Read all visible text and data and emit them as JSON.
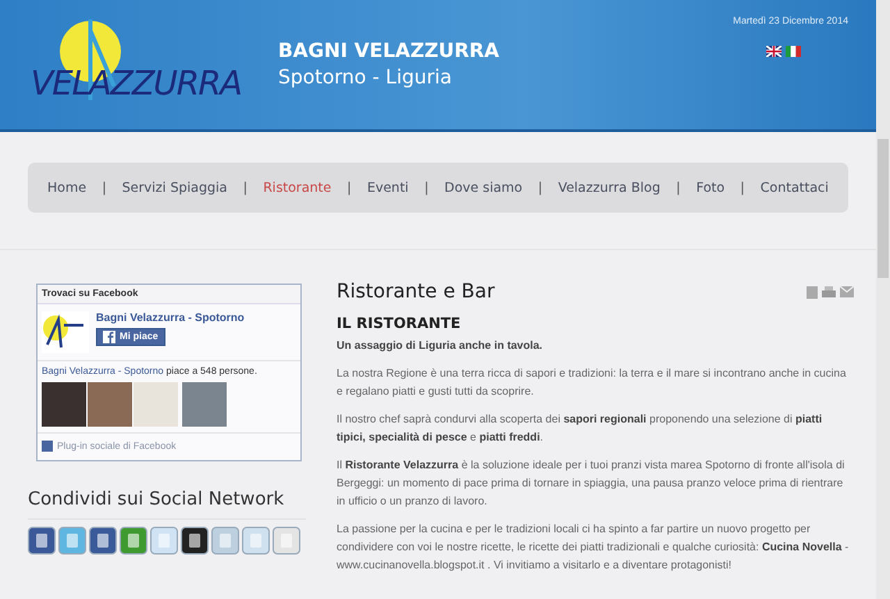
{
  "header": {
    "logo_text": "VELAZZURRA",
    "title": "BAGNI VELAZZURRA",
    "subtitle": "Spotorno - Liguria",
    "date": "Martedì 23 Dicembre 2014"
  },
  "nav": [
    {
      "label": "Home",
      "selected": false
    },
    {
      "label": "Servizi Spiaggia",
      "selected": false
    },
    {
      "label": "Ristorante",
      "selected": true
    },
    {
      "label": "Eventi",
      "selected": false
    },
    {
      "label": "Dove siamo",
      "selected": false
    },
    {
      "label": "Velazzurra Blog",
      "selected": false
    },
    {
      "label": "Foto",
      "selected": false
    },
    {
      "label": "Contattaci",
      "selected": false
    }
  ],
  "nav_separator": "|",
  "facebook_box": {
    "title": "Trovaci su Facebook",
    "page_name": "Bagni Velazzurra - Spotorno",
    "like_button": "Mi piace",
    "fans_link": "Bagni Velazzurra - Spotorno",
    "fans_text": "piace a 548 persone.",
    "footer": "Plug-in sociale di Facebook"
  },
  "share": {
    "title": "Condividi sui Social Network"
  },
  "article": {
    "title": "Ristorante e Bar",
    "heading": "IL RISTORANTE",
    "lead": "Un assaggio di Liguria anche in tavola.",
    "paragraphs": [
      "La nostra Regione è una terra ricca di sapori e tradizioni: la terra e il mare si incontrano anche in cucina e regalano piatti e gusti tutti da scoprire.",
      "Il nostro chef saprà condurvi alla scoperta dei **sapori regionali** proponendo una selezione di **piatti tipici, specialità di pesce** e **piatti freddi**.",
      "Il **Ristorante Velazzurra** è la soluzione ideale per i tuoi pranzi vista marea Spotorno di fronte all'isola di Bergeggi: un momento di pace prima di tornare in spiaggia, una pausa pranzo veloce prima di rientrare in ufficio o un pranzo di lavoro.",
      "La passione per la cucina e per le tradizioni locali ci ha spinto a far partire un nuovo progetto per condividere con voi le nostre ricette, le ricette dei piatti tradizionali e qualche curiosità: **Cucina Novella** - www.cucinanovella.blogspot.it .  Vi invitiamo a visitarlo e a diventare protagonisti!"
    ]
  }
}
